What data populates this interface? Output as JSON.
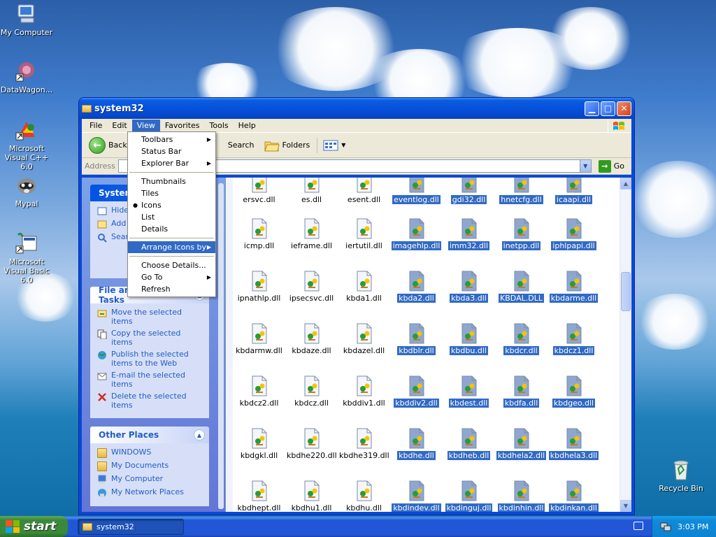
{
  "desktop": {
    "icons": [
      {
        "label": "My Computer"
      },
      {
        "label": "DataWagon..."
      },
      {
        "label": "Microsoft Visual C++ 6.0"
      },
      {
        "label": "Mypal"
      },
      {
        "label": "Microsoft Visual Basic 6.0"
      },
      {
        "label": "Recycle Bin"
      }
    ]
  },
  "window": {
    "title": "system32",
    "menu": [
      "File",
      "Edit",
      "View",
      "Favorites",
      "Tools",
      "Help"
    ],
    "toolbar": {
      "back": "Back",
      "search": "Search",
      "folders": "Folders"
    },
    "address": {
      "label": "Address",
      "go": "Go"
    }
  },
  "view_menu": {
    "items": [
      {
        "label": "Toolbars",
        "submenu": true
      },
      {
        "label": "Status Bar"
      },
      {
        "label": "Explorer Bar",
        "submenu": true
      },
      {
        "sep": true
      },
      {
        "label": "Thumbnails"
      },
      {
        "label": "Tiles"
      },
      {
        "label": "Icons",
        "checked": true
      },
      {
        "label": "List"
      },
      {
        "label": "Details"
      },
      {
        "sep": true
      },
      {
        "label": "Arrange Icons by",
        "submenu": true,
        "highlighted": true
      },
      {
        "sep": true
      },
      {
        "label": "Choose Details..."
      },
      {
        "label": "Go To",
        "submenu": true
      },
      {
        "label": "Refresh"
      }
    ]
  },
  "tasks": {
    "system_header": "System",
    "system_items": [
      "Hide this",
      "Add prog",
      "Sear folde"
    ],
    "file_header": "File and Folder Tasks",
    "file_items": [
      "Move the selected items",
      "Copy the selected items",
      "Publish the selected items to the Web",
      "E-mail the selected items",
      "Delete the selected items"
    ],
    "other_header": "Other Places",
    "other_items": [
      "WINDOWS",
      "My Documents",
      "My Computer",
      "My Network Places"
    ]
  },
  "files": [
    {
      "name": "ersvc.dll"
    },
    {
      "name": "es.dll"
    },
    {
      "name": "esent.dll"
    },
    {
      "name": "eventlog.dll",
      "selected": true
    },
    {
      "name": "gdi32.dll",
      "selected": true
    },
    {
      "name": "hnetcfg.dll",
      "selected": true
    },
    {
      "name": "icaapi.dll",
      "selected": true
    },
    {
      "name": "icmp.dll"
    },
    {
      "name": "ieframe.dll"
    },
    {
      "name": "iertutil.dll"
    },
    {
      "name": "imagehlp.dll",
      "selected": true
    },
    {
      "name": "imm32.dll",
      "selected": true
    },
    {
      "name": "inetpp.dll",
      "selected": true
    },
    {
      "name": "iphlpapi.dll",
      "selected": true
    },
    {
      "name": "ipnathlp.dll"
    },
    {
      "name": "ipsecsvc.dll"
    },
    {
      "name": "kbda1.dll"
    },
    {
      "name": "kbda2.dll",
      "selected": true
    },
    {
      "name": "kbda3.dll",
      "selected": true
    },
    {
      "name": "KBDAL.DLL",
      "selected": true
    },
    {
      "name": "kbdarme.dll",
      "selected": true
    },
    {
      "name": "kbdarmw.dll"
    },
    {
      "name": "kbdaze.dll"
    },
    {
      "name": "kbdazel.dll"
    },
    {
      "name": "kbdblr.dll",
      "selected": true
    },
    {
      "name": "kbdbu.dll",
      "selected": true
    },
    {
      "name": "kbdcr.dll",
      "selected": true
    },
    {
      "name": "kbdcz1.dll",
      "selected": true
    },
    {
      "name": "kbdcz2.dll"
    },
    {
      "name": "kbdcz.dll"
    },
    {
      "name": "kbddiv1.dll"
    },
    {
      "name": "kbddiv2.dll",
      "selected": true
    },
    {
      "name": "kbdest.dll",
      "selected": true
    },
    {
      "name": "kbdfa.dll",
      "selected": true
    },
    {
      "name": "kbdgeo.dll",
      "selected": true
    },
    {
      "name": "kbdgkl.dll"
    },
    {
      "name": "kbdhe220.dll"
    },
    {
      "name": "kbdhe319.dll"
    },
    {
      "name": "kbdhe.dll",
      "selected": true
    },
    {
      "name": "kbdheb.dll",
      "selected": true
    },
    {
      "name": "kbdhela2.dll",
      "selected": true
    },
    {
      "name": "kbdhela3.dll",
      "selected": true
    },
    {
      "name": "kbdhept.dll"
    },
    {
      "name": "kbdhu1.dll"
    },
    {
      "name": "kbdhu.dll"
    },
    {
      "name": "kbdindev.dll",
      "selected": true
    },
    {
      "name": "kbdinguj.dll",
      "selected": true
    },
    {
      "name": "kbdinhin.dll",
      "selected": true
    },
    {
      "name": "kbdinkan.dll",
      "selected": true
    }
  ],
  "taskbar": {
    "start": "start",
    "task": "system32",
    "clock": "3:03 PM"
  },
  "colors": {
    "selection": "#316ac5",
    "titlebar": "#0a5de0",
    "start": "#3c873c"
  }
}
